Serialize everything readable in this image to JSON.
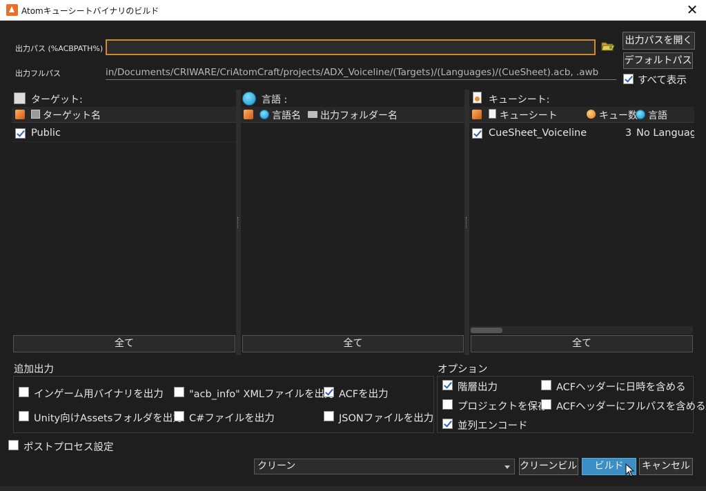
{
  "window": {
    "title": "Atomキューシートバイナリのビルド",
    "close_glyph": "✕"
  },
  "output_path": {
    "label": "出力パス (%ACBPATH%)",
    "value": ""
  },
  "full_path": {
    "label": "出力フルパス",
    "value": "in/Documents/CRIWARE/CriAtomCraft/projects/ADX_Voiceline/(Targets)/(Languages)/(CueSheet).acb, .awb"
  },
  "side_buttons": {
    "open": "出力パスを開く",
    "default": "デフォルトパス"
  },
  "show_all": {
    "label": "すべて表示",
    "checked": true
  },
  "panels": {
    "target": {
      "header": "ターゲット:",
      "column": "ターゲット名",
      "rows": [
        {
          "label": "Public",
          "checked": true
        }
      ],
      "all_button": "全て"
    },
    "language": {
      "header": "言語 :",
      "columns": [
        "言語名",
        "出力フォルダー名"
      ],
      "rows": [],
      "all_button": "全て"
    },
    "cuesheet": {
      "header": "キューシート:",
      "columns": [
        "キューシート",
        "キュー数",
        "言語"
      ],
      "rows": [
        {
          "name": "CueSheet_Voiceline",
          "count": "3",
          "language": "No Languag",
          "checked": true
        }
      ],
      "all_button": "全て"
    }
  },
  "extra_output": {
    "title": "追加出力",
    "items": [
      {
        "label": "インゲーム用バイナリを出力",
        "checked": false
      },
      {
        "label": "\"acb_info\" XMLファイルを出力",
        "checked": false
      },
      {
        "label": "ACFを出力",
        "checked": true
      },
      {
        "label": "Unity向けAssetsフォルダを出力",
        "checked": false
      },
      {
        "label": "C#ファイルを出力",
        "checked": false
      },
      {
        "label": "JSONファイルを出力",
        "checked": false
      }
    ]
  },
  "options": {
    "title": "オプション",
    "items": [
      {
        "label": "階層出力",
        "checked": true
      },
      {
        "label": "ACFヘッダーに日時を含める",
        "checked": false
      },
      {
        "label": "プロジェクトを保存",
        "checked": false
      },
      {
        "label": "ACFヘッダーにフルパスを含める",
        "checked": false
      },
      {
        "label": "並列エンコード",
        "checked": true
      }
    ]
  },
  "post_process": {
    "label": "ポストプロセス設定",
    "checked": false
  },
  "build_mode": {
    "selected": "クリーン"
  },
  "buttons": {
    "clean_build": "クリーンビルド",
    "build": "ビルド",
    "cancel": "キャンセル"
  },
  "colors": {
    "accent_orange": "#d38a2a",
    "build_button": "#3b8fc4",
    "background": "#1e1e1e"
  },
  "icons": {
    "target": "target-icon",
    "language": "globe-icon",
    "cuesheet": "document-icon",
    "folder": "folder-icon",
    "browse": "folder-open-icon"
  }
}
